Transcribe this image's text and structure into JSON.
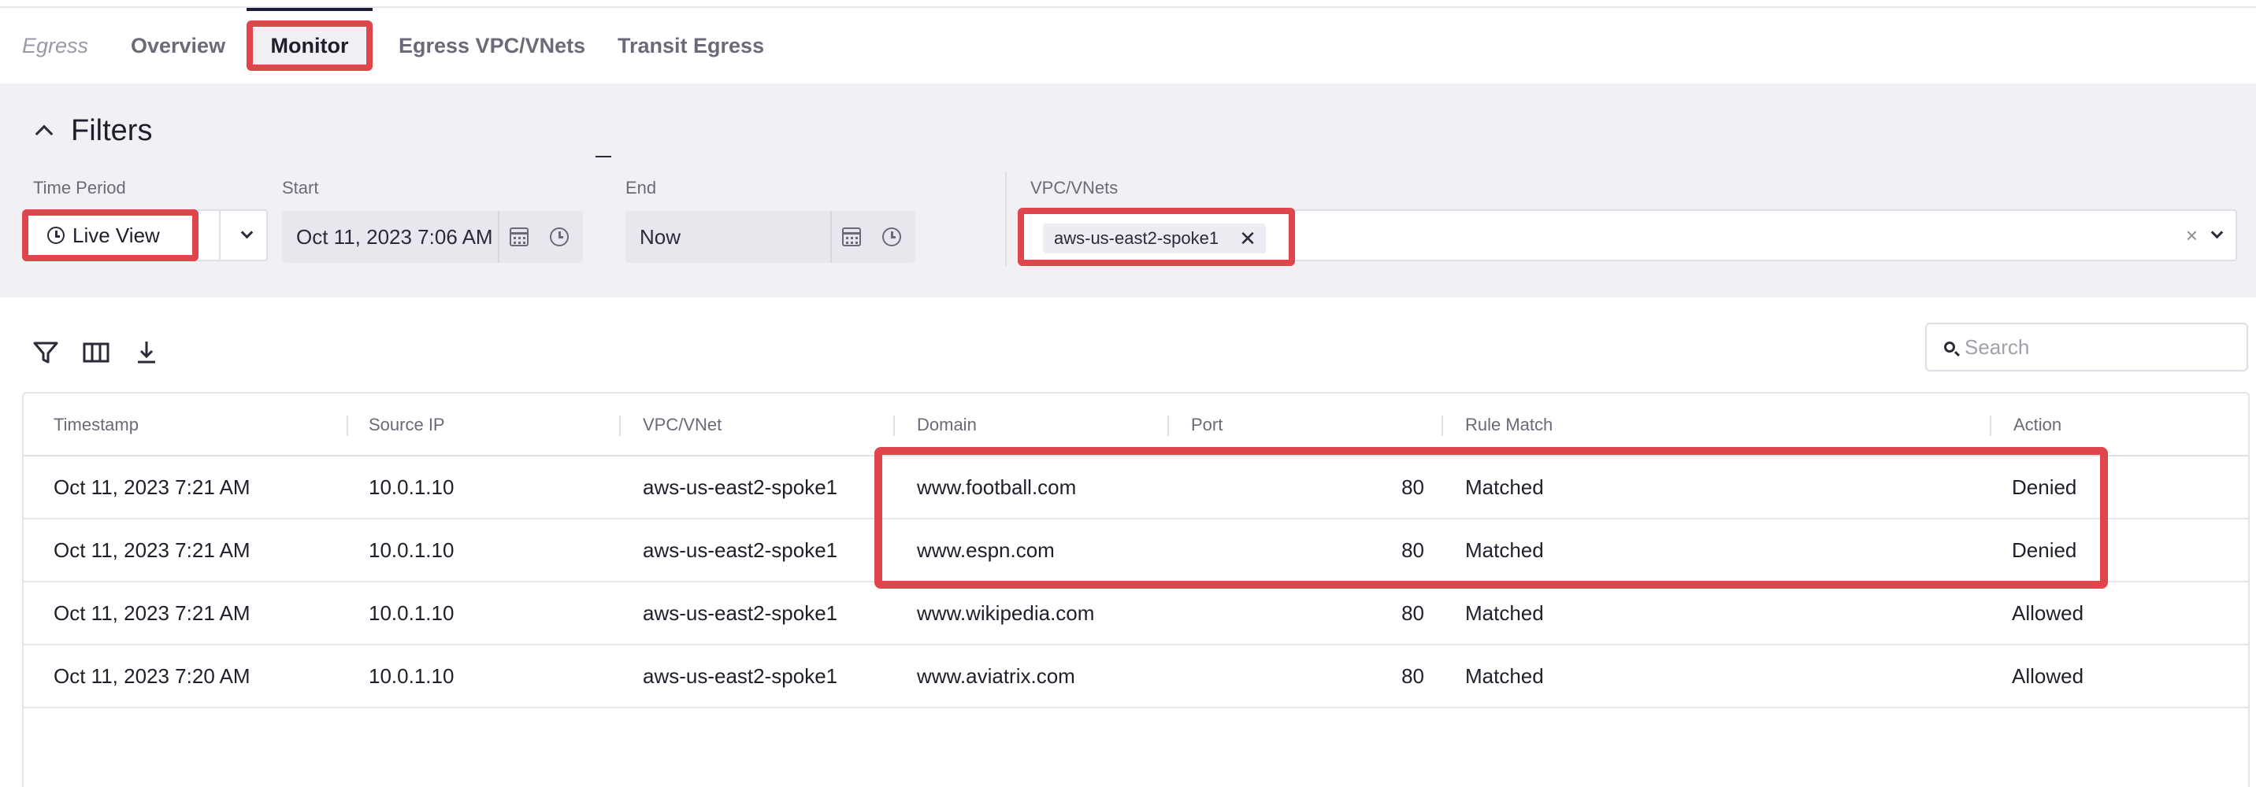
{
  "tabs": {
    "egress": "Egress",
    "overview": "Overview",
    "monitor": "Monitor",
    "egress_vpc_vnets": "Egress VPC/VNets",
    "transit_egress": "Transit Egress"
  },
  "filters": {
    "title": "Filters",
    "time_period": {
      "label": "Time Period",
      "value": "Live View"
    },
    "start": {
      "label": "Start",
      "value": "Oct 11, 2023 7:06 AM"
    },
    "end": {
      "label": "End",
      "value": "Now"
    },
    "vpc_vnets": {
      "label": "VPC/VNets",
      "chips": [
        "aws-us-east2-spoke1"
      ]
    }
  },
  "toolbar": {
    "icons": [
      "filter-icon",
      "columns-icon",
      "download-icon"
    ],
    "search_placeholder": "Search"
  },
  "table": {
    "columns": [
      "Timestamp",
      "Source IP",
      "VPC/VNet",
      "Domain",
      "Port",
      "Rule Match",
      "Action"
    ],
    "rows": [
      {
        "timestamp": "Oct 11, 2023 7:21 AM",
        "source_ip": "10.0.1.10",
        "vpc": "aws-us-east2-spoke1",
        "domain": "www.football.com",
        "port": "80",
        "rule_match": "Matched",
        "action": "Denied"
      },
      {
        "timestamp": "Oct 11, 2023 7:21 AM",
        "source_ip": "10.0.1.10",
        "vpc": "aws-us-east2-spoke1",
        "domain": "www.espn.com",
        "port": "80",
        "rule_match": "Matched",
        "action": "Denied"
      },
      {
        "timestamp": "Oct 11, 2023 7:21 AM",
        "source_ip": "10.0.1.10",
        "vpc": "aws-us-east2-spoke1",
        "domain": "www.wikipedia.com",
        "port": "80",
        "rule_match": "Matched",
        "action": "Allowed"
      },
      {
        "timestamp": "Oct 11, 2023 7:20 AM",
        "source_ip": "10.0.1.10",
        "vpc": "aws-us-east2-spoke1",
        "domain": "www.aviatrix.com",
        "port": "80",
        "rule_match": "Matched",
        "action": "Allowed"
      }
    ]
  },
  "colors": {
    "highlight": "#e0454c",
    "panel_bg": "#f1f1f5",
    "active_tab_indicator": "#1b1b3a"
  }
}
